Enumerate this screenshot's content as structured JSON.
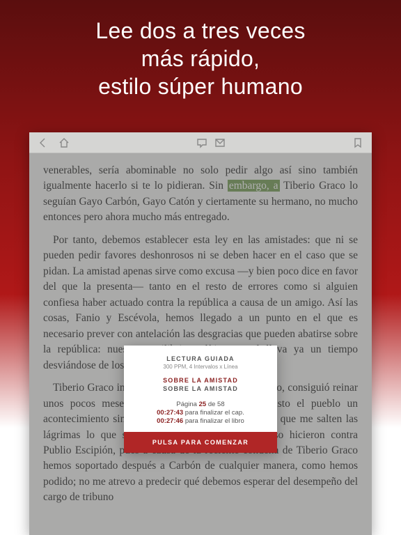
{
  "hero": {
    "line1": "Lee dos a tres veces",
    "line2": "más rápido,",
    "line3": "estilo súper humano"
  },
  "reader": {
    "highlighted": "embargo, a",
    "para1_pre": "venerables, sería abominable no solo pedir algo así sino también igualmente hacerlo si te lo pidieran. Sin ",
    "para1_post": " Tiberio Graco lo seguían Gayo Carbón, Gayo Catón y ciertamente su hermano, no mucho entonces pero ahora mucho más entregado.",
    "para2": "Por tanto, debemos establecer esta ley en las amistades: que ni se pueden pedir favores deshonrosos ni se deben hacer en el caso que se pidan. La amistad apenas sirve como excusa —y bien poco dice en favor del que la presenta— tanto en el resto de errores como si alguien confiesa haber actuado contra la república a causa de un amigo. Así las cosas, Fanio y Escévola, hemos llegado a un punto en el que es necesario prever con antelación las desgracias que pueden abatirse sobre la república: nuestro equilibrio político actual lleva ya un tiempo desviándose de los usos de nuestros antepasados.",
    "para3": "Tiberio Graco intentó ocupar el trono o, mejor dicho, consiguió reinar unos pocos meses. ¿Había alguna vez oído o visto el pueblo un acontecimiento similar? Y no soy capaz de decir sin que me salten las lágrimas lo que sus seguidores y allegados incluso hicieron contra Publio Escipión, pues a causa de la reciente condena de Tiberio Graco hemos soportado después a Carbón de cualquier manera, como hemos podido; no me atrevo a predecir qué debemos esperar del desempeño del cargo de tribuno"
  },
  "popup": {
    "title": "LECTURA GUIADA",
    "subtitle": "300 PPM, 4 Intervalos x Línea",
    "book": "SOBRE LA AMISTAD",
    "chapter": "SOBRE LA AMISTAD",
    "page_prefix": "Página ",
    "page_current": "25",
    "page_mid": " de ",
    "page_total": "58",
    "time_chapter": "00:27:43",
    "time_chapter_suffix": " para finalizar el cap.",
    "time_book": "00:27:46",
    "time_book_suffix": " para finalizar el libro",
    "cta": "PULSA PARA COMENZAR"
  }
}
